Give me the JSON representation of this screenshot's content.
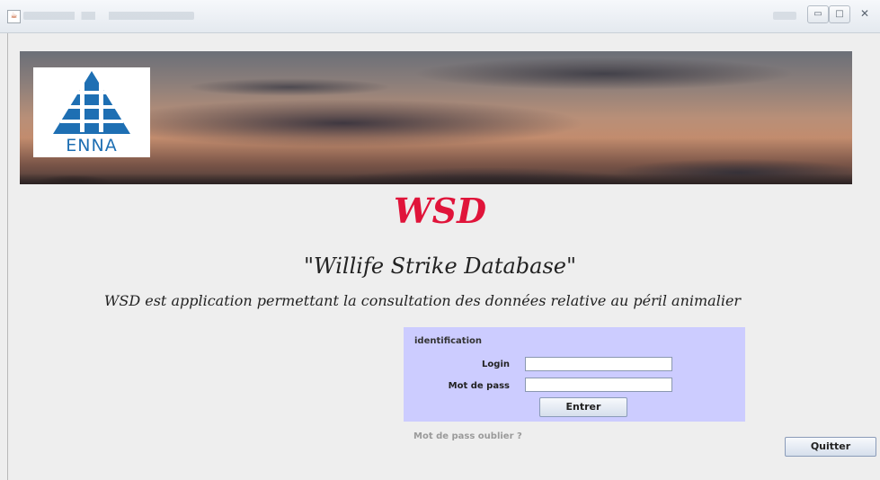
{
  "window": {
    "title_blurred": true
  },
  "header": {
    "logo_text": "ENNA"
  },
  "main": {
    "app_title": "WSD",
    "app_subtitle": "\"Willife Strike Database\"",
    "description": "WSD est application permettant la consultation des données relative au péril animalier"
  },
  "login": {
    "title": "identification",
    "login_label": "Login",
    "login_value": "",
    "password_label": "Mot de pass",
    "password_value": "",
    "enter_label": "Entrer",
    "forgot_label": "Mot de pass oublier ?"
  },
  "actions": {
    "quit_label": "Quitter"
  },
  "colors": {
    "title_red": "#e0143a",
    "panel_bg": "#ccccff",
    "logo_blue": "#1e6fb3"
  },
  "icons": {
    "app": "java-icon",
    "minimize": "minimize-icon",
    "maximize": "maximize-icon",
    "close": "close-icon"
  }
}
